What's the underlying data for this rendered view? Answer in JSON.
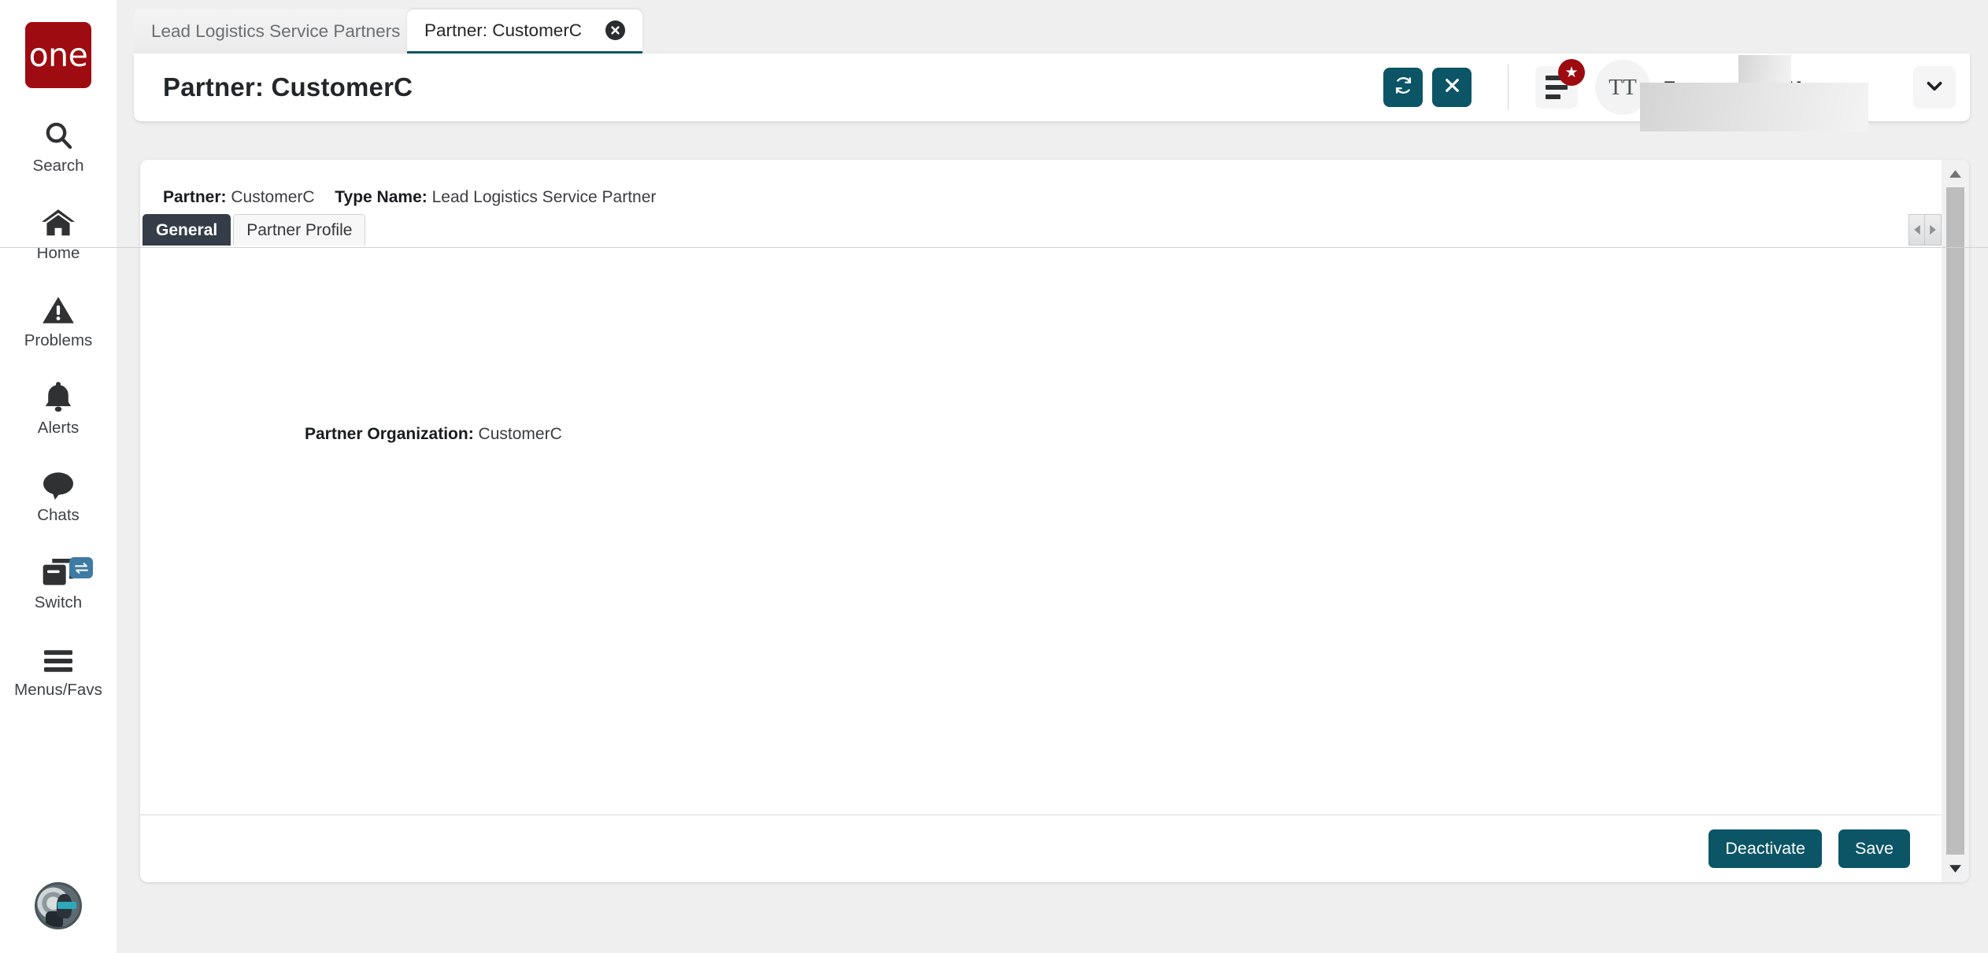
{
  "brand": {
    "logo_text": "one",
    "logo_color": "#9e0b10"
  },
  "sidebar": {
    "items": [
      {
        "label": "Search",
        "icon": "search-icon"
      },
      {
        "label": "Home",
        "icon": "home-icon"
      },
      {
        "label": "Problems",
        "icon": "warning-triangle-icon"
      },
      {
        "label": "Alerts",
        "icon": "bell-icon"
      },
      {
        "label": "Chats",
        "icon": "chat-bubble-icon"
      },
      {
        "label": "Switch",
        "icon": "windows-stack-icon",
        "badge_icon": "swap-arrows-icon"
      },
      {
        "label": "Menus/Favs",
        "icon": "hamburger-icon"
      }
    ],
    "avatar_icon": "robot-avatar-icon"
  },
  "tabs": [
    {
      "label": "Lead Logistics Service Partners",
      "active": false,
      "close_icon": "close-circle-icon"
    },
    {
      "label": "Partner: CustomerC",
      "active": true,
      "close_icon": "close-circle-icon"
    }
  ],
  "header": {
    "title": "Partner: CustomerC",
    "refresh_icon": "refresh-icon",
    "close_icon": "close-x-icon",
    "menu_icon": "list-menu-icon",
    "badge_icon": "star-icon",
    "badge_color": "#9d0a0f",
    "avatar_initials": "TT",
    "user_role": "Transportation Manager",
    "caret_icon": "chevron-down-icon",
    "accent_color": "#0c5567"
  },
  "content": {
    "summary": {
      "partner_label": "Partner:",
      "partner_value": "CustomerC",
      "type_label": "Type Name:",
      "type_value": "Lead Logistics Service Partner"
    },
    "subtabs": [
      {
        "label": "General",
        "active": true
      },
      {
        "label": "Partner Profile",
        "active": false
      }
    ],
    "scroll_left_icon": "triangle-left-icon",
    "scroll_right_icon": "triangle-right-icon",
    "fields": [
      {
        "label": "Partner Organization:",
        "value": "CustomerC"
      }
    ],
    "actions": [
      {
        "label": "Deactivate"
      },
      {
        "label": "Save"
      }
    ],
    "scroll_up_icon": "triangle-up-icon",
    "scroll_down_icon": "triangle-down-icon"
  }
}
